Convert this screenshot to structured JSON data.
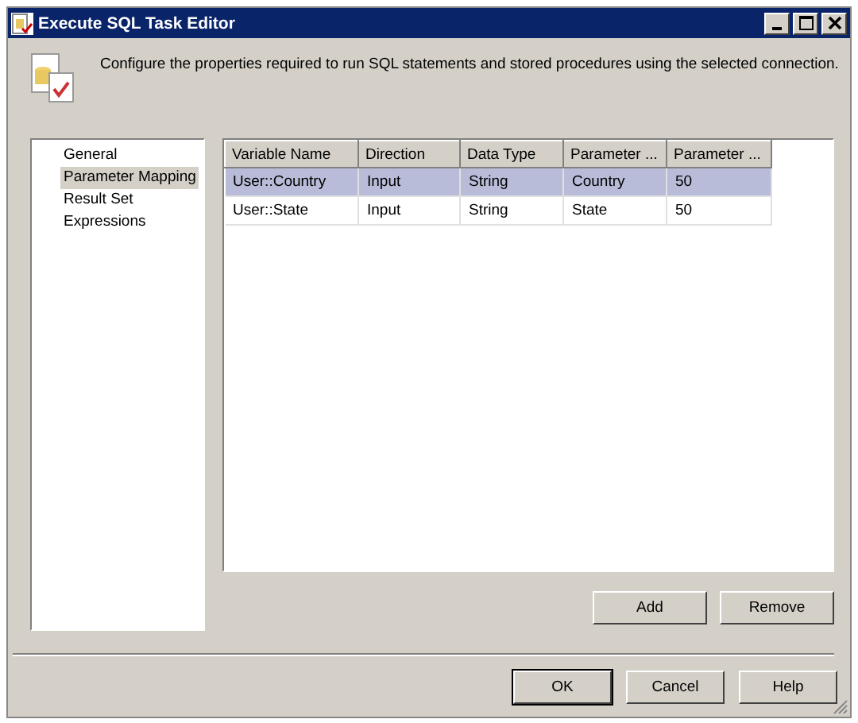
{
  "window": {
    "title": "Execute SQL Task Editor"
  },
  "header": {
    "description": "Configure the properties required to run SQL statements and stored procedures using the selected connection."
  },
  "sidebar": {
    "items": [
      {
        "label": "General",
        "selected": false
      },
      {
        "label": "Parameter Mapping",
        "selected": true
      },
      {
        "label": "Result Set",
        "selected": false
      },
      {
        "label": "Expressions",
        "selected": false
      }
    ]
  },
  "table": {
    "columns": [
      "Variable Name",
      "Direction",
      "Data Type",
      "Parameter ...",
      "Parameter ..."
    ],
    "rows": [
      {
        "cells": [
          "User::Country",
          "Input",
          "String",
          "Country",
          "50"
        ],
        "selected": true
      },
      {
        "cells": [
          "User::State",
          "Input",
          "String",
          "State",
          "50"
        ],
        "selected": false
      }
    ]
  },
  "table_buttons": [
    "Add",
    "Remove"
  ],
  "dialog_buttons": [
    {
      "label": "OK",
      "default": true
    },
    {
      "label": "Cancel",
      "default": false
    },
    {
      "label": "Help",
      "default": false
    }
  ]
}
